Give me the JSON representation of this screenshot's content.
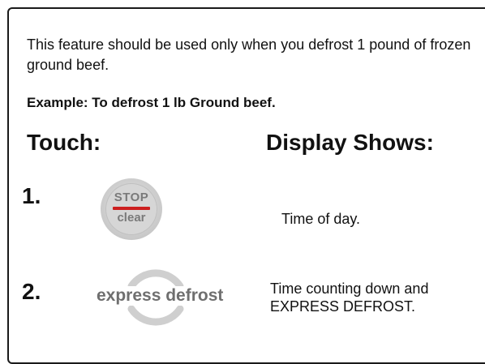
{
  "intro_text": "This feature should be used only when you defrost 1 pound of frozen ground beef.",
  "example_text": "Example: To defrost 1 lb Ground beef.",
  "headers": {
    "touch": "Touch:",
    "display": "Display Shows:"
  },
  "steps": [
    {
      "number": "1.",
      "button": {
        "icon": "stop-clear-button-icon",
        "line1": "STOP",
        "line2": "clear"
      },
      "display": "Time of day."
    },
    {
      "number": "2.",
      "button": {
        "icon": "express-defrost-button-icon",
        "label": "express defrost"
      },
      "display_line1": "Time counting down and",
      "display_line2": "EXPRESS DEFROST."
    }
  ],
  "colors": {
    "button_gray": "#d6d6d6",
    "button_text": "#7a7a7a",
    "stop_bar_red": "#cc1f1f"
  }
}
